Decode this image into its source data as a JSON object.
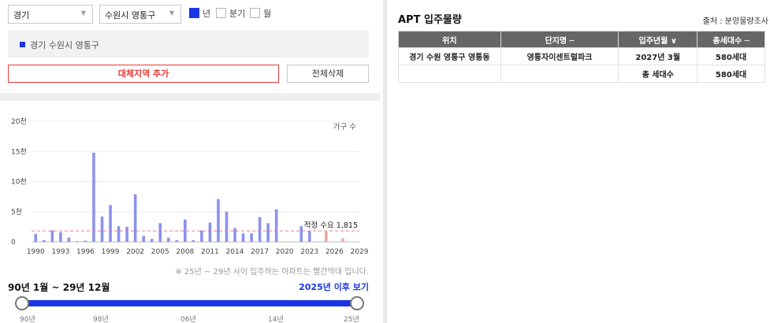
{
  "filters": {
    "region": "경기",
    "district": "수원시 영통구",
    "period_options": [
      {
        "label": "년",
        "checked": true
      },
      {
        "label": "분기",
        "checked": false
      },
      {
        "label": "월",
        "checked": false
      }
    ]
  },
  "selected_region": "경기 수원시 영통구",
  "buttons": {
    "add_region": "대체지역 추가",
    "clear_all": "전체삭제"
  },
  "chart_data": {
    "type": "bar",
    "series_label": "가구 수",
    "y_ticks": [
      "20천",
      "15천",
      "10천",
      "5천",
      "0"
    ],
    "ylim": [
      0,
      20000
    ],
    "x_ticks": [
      "1990",
      "1993",
      "1996",
      "1999",
      "2002",
      "2005",
      "2008",
      "2011",
      "2014",
      "2017",
      "2020",
      "2023",
      "2026",
      "2029"
    ],
    "xlim": [
      1989.5,
      2029
    ],
    "categories": [
      1990,
      1991,
      1992,
      1993,
      1994,
      1995,
      1996,
      1997,
      1998,
      1999,
      2000,
      2001,
      2002,
      2003,
      2004,
      2005,
      2006,
      2007,
      2008,
      2009,
      2010,
      2011,
      2012,
      2013,
      2014,
      2015,
      2016,
      2017,
      2018,
      2019,
      2020,
      2021,
      2022,
      2023,
      2024,
      2025,
      2026,
      2027
    ],
    "values": [
      1300,
      300,
      1900,
      1600,
      700,
      100,
      200,
      14800,
      4200,
      6100,
      2600,
      2500,
      7900,
      1000,
      500,
      3100,
      700,
      300,
      3700,
      300,
      1900,
      3200,
      7100,
      5000,
      2300,
      1400,
      1400,
      4100,
      3100,
      5400,
      0,
      0,
      2600,
      1800,
      0,
      1700,
      0,
      600
    ],
    "future_from": 2025,
    "colors": {
      "past": "#8a92f0",
      "future": "#f4a6a0",
      "demand_line": "#e98080"
    },
    "demand_value": 1815,
    "demand_label": "적정 수요 1,815"
  },
  "note": "※ 25년 ~ 29년 사이 입주하는 아파트는 빨간막대 입니다.",
  "range": {
    "label": "90년 1월 ~ 29년 12월",
    "link": "2025년 이후 보기",
    "ticks": [
      "90년",
      "98년",
      "06년",
      "14년",
      "25년"
    ]
  },
  "apt": {
    "title": "APT 입주물량",
    "source": "출처 : 분양물량조사",
    "headers": [
      "위치",
      "단지명 ─",
      "입주년월 ∨",
      "총세대수 ─"
    ],
    "rows": [
      [
        "경기 수원 영통구 영통동",
        "영통자이센트럴파크",
        "2027년 3월",
        "580세대"
      ]
    ],
    "total": {
      "label": "총 세대수",
      "value": "580세대"
    }
  }
}
